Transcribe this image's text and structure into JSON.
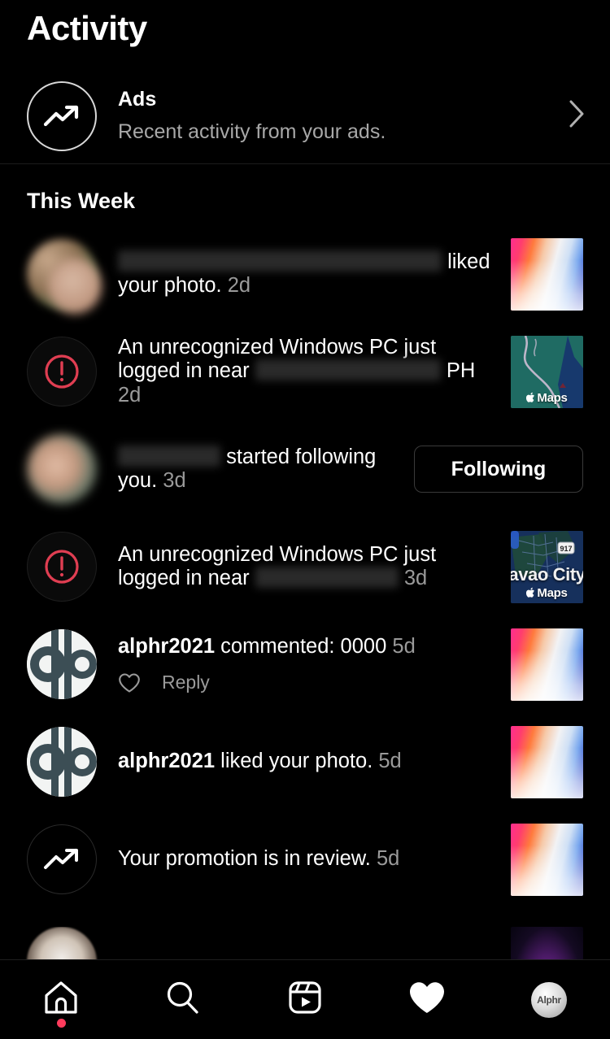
{
  "header": {
    "title": "Activity"
  },
  "ads": {
    "icon": "trending-up-icon",
    "title": "Ads",
    "subtitle": "Recent activity from your ads.",
    "chevron": "chevron-right-icon"
  },
  "section": {
    "title": "This Week"
  },
  "colors": {
    "background": "#000000",
    "text_primary": "#ffffff",
    "text_secondary": "#9a9a9a",
    "alert_red": "#e03e52",
    "badge_red": "#ff3b5c",
    "divider": "#1f1f1f",
    "button_border": "#3a3a3a"
  },
  "notifications": [
    {
      "id": "row-liked-photo-blurred",
      "avatar_type": "stacked-blurred-avatars",
      "username_redacted": true,
      "redact_width": 398,
      "text_before": "",
      "text_after": " liked your photo.",
      "time": "2d",
      "thumb_type": "gradient-photo",
      "action": null
    },
    {
      "id": "row-login-alert-1",
      "avatar_type": "alert-icon",
      "icon": "alert-circle-icon",
      "text_before": "An unrecognized Windows PC just logged in near",
      "username_redacted": true,
      "redact_width": 228,
      "text_after": " PH",
      "time": "2d",
      "thumb_type": "apple-maps-teal",
      "maps_label": "Maps",
      "action": null
    },
    {
      "id": "row-started-following",
      "avatar_type": "blurred-portrait",
      "username_redacted": true,
      "redact_width": 126,
      "text_before": "",
      "text_after": " started following you.",
      "time": "3d",
      "thumb_type": null,
      "action": {
        "type": "button",
        "label": "Following",
        "name": "following-button"
      }
    },
    {
      "id": "row-login-alert-2",
      "avatar_type": "alert-icon",
      "icon": "alert-circle-icon",
      "text_before": "An unrecognized Windows PC just logged in near",
      "username_redacted": true,
      "redact_width": 176,
      "text_after": "",
      "time": "3d",
      "thumb_type": "apple-maps-city",
      "maps_label": "Maps",
      "city_label": "avao City",
      "highway_shield": "917",
      "action": null
    },
    {
      "id": "row-commented",
      "avatar_type": "alphr-logo",
      "username": "alphr2021",
      "text_after": " commented: 0000",
      "time": "5d",
      "thumb_type": "gradient-photo",
      "reply": {
        "heart_icon": "heart-outline-icon",
        "label": "Reply"
      },
      "action": null
    },
    {
      "id": "row-liked-photo-alphr",
      "avatar_type": "alphr-logo",
      "username": "alphr2021",
      "text_after": " liked your photo.",
      "time": "5d",
      "thumb_type": "gradient-photo",
      "action": null
    },
    {
      "id": "row-promotion-review",
      "avatar_type": "promotion-icon",
      "icon": "trending-up-icon",
      "text_after": "Your promotion is in review.",
      "time": "5d",
      "thumb_type": "gradient-photo",
      "action": null
    }
  ],
  "partial_row": {
    "id": "row-partial-cutoff",
    "avatar_type": "portrait-photo",
    "thumb_type": "dark-purple-photo"
  },
  "bottom_nav": [
    {
      "name": "nav-home",
      "icon": "home-icon",
      "active": false,
      "badge": true
    },
    {
      "name": "nav-search",
      "icon": "search-icon",
      "active": false,
      "badge": false
    },
    {
      "name": "nav-reels",
      "icon": "reels-icon",
      "active": false,
      "badge": false
    },
    {
      "name": "nav-activity",
      "icon": "heart-filled-icon",
      "active": true,
      "badge": false
    },
    {
      "name": "nav-profile",
      "icon": "profile-avatar",
      "active": false,
      "badge": false,
      "avatar_text": "Alphr"
    }
  ]
}
